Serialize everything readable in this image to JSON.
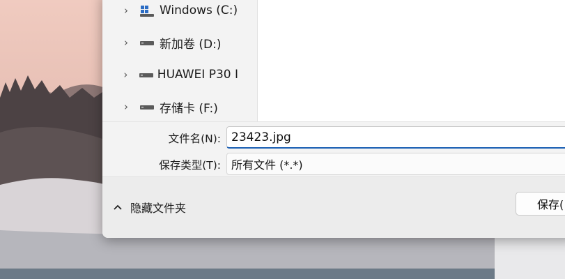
{
  "nav_tree": {
    "items": [
      {
        "label": "Windows (C:)",
        "icon": "windows-drive-icon"
      },
      {
        "label": "新加卷 (D:)",
        "icon": "drive-icon"
      },
      {
        "label": "HUAWEI P30 I",
        "icon": "drive-icon"
      },
      {
        "label": "存储卡 (F:)",
        "icon": "drive-icon"
      }
    ]
  },
  "form": {
    "filename_label": "文件名(N):",
    "filename_value": "23423.jpg",
    "filetype_label": "保存类型(T):",
    "filetype_value": "所有文件 (*.*)"
  },
  "footer": {
    "hide_folders_label": "隐藏文件夹",
    "save_label": "保存("
  },
  "colors": {
    "accent": "#1a5fb4",
    "dialog_bg": "#f3f3f3"
  }
}
